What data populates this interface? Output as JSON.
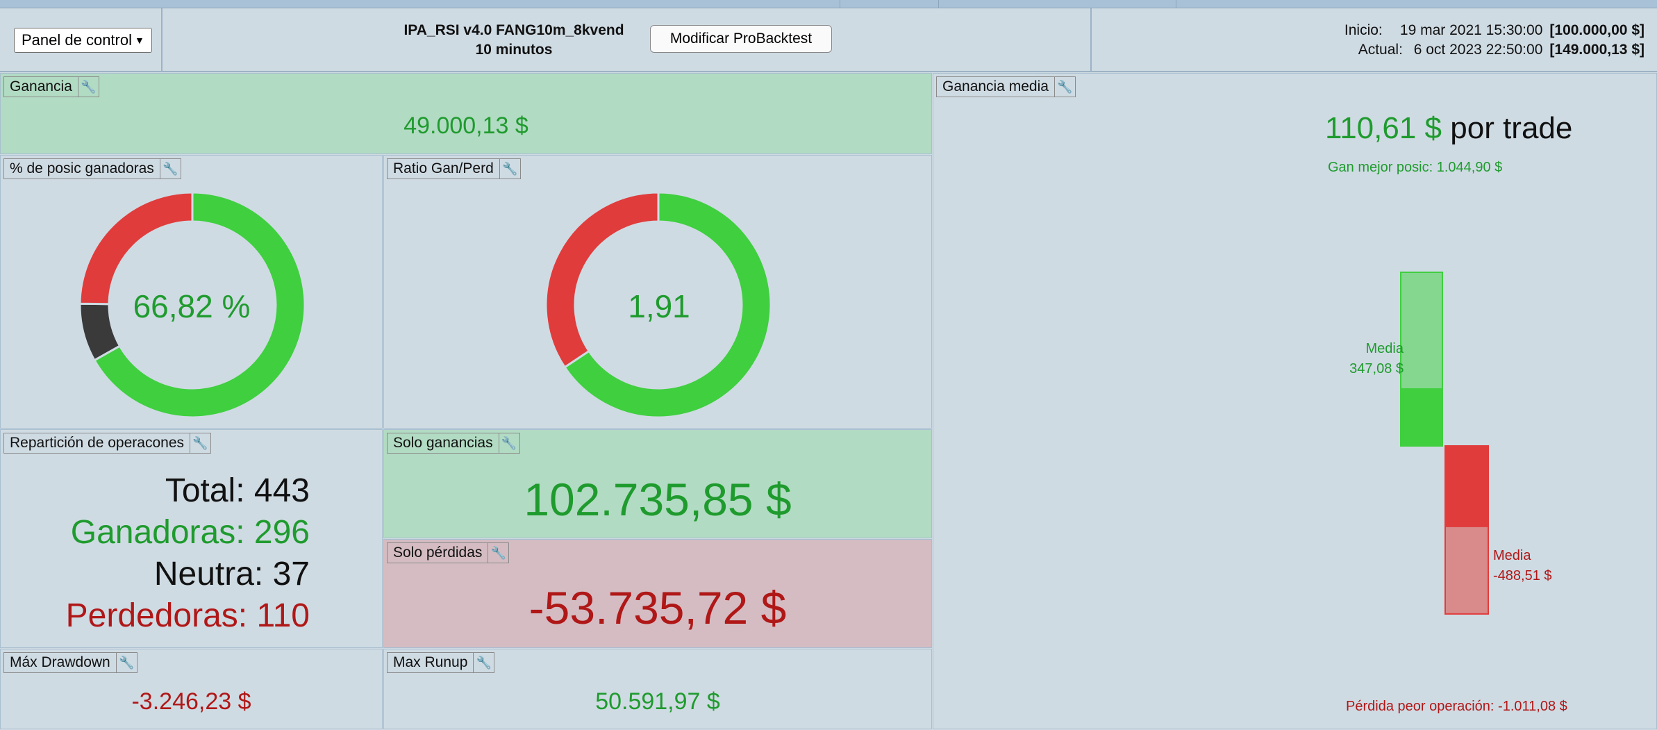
{
  "header": {
    "dashboard_label": "Panel de control",
    "strategy_name": "IPA_RSI v4.0 FANG10m_8kvend",
    "timeframe": "10 minutos",
    "modify_button": "Modificar ProBacktest",
    "start_label": "Inicio:",
    "start_date": "19 mar 2021 15:30:00",
    "start_value": "[100.000,00 $]",
    "current_label": "Actual:",
    "current_date": "6 oct 2023 22:50:00",
    "current_value": "[149.000,13 $]"
  },
  "panels": {
    "gain": {
      "title": "Ganancia",
      "value": "49.000,13 $"
    },
    "winning_pct": {
      "title": "% de posic ganadoras",
      "value": "66,82 %"
    },
    "ratio": {
      "title": "Ratio Gan/Perd",
      "value": "1,91"
    },
    "breakdown": {
      "title": "Repartición de operacones",
      "total_label": "Total:",
      "total": "443",
      "winners_label": "Ganadoras:",
      "winners": "296",
      "neutral_label": "Neutra:",
      "neutral": "37",
      "losers_label": "Perdedoras:",
      "losers": "110"
    },
    "only_gains": {
      "title": "Solo ganancias",
      "value": "102.735,85 $"
    },
    "only_losses": {
      "title": "Solo pérdidas",
      "value": "-53.735,72 $"
    },
    "max_drawdown": {
      "title": "Máx Drawdown",
      "value": "-3.246,23 $"
    },
    "max_runup": {
      "title": "Max Runup",
      "value": "50.591,97 $"
    },
    "avg_gain": {
      "title": "Ganancia media",
      "per_trade_value": "110,61 $",
      "per_trade_label": "por trade",
      "best_label": "Gan mejor posic: 1.044,90 $",
      "avg_win_label": "Media",
      "avg_win_value": "347,08 $",
      "avg_loss_label": "Media",
      "avg_loss_value": "-488,51 $",
      "worst_label": "Pérdida peor operación: -1.011,08 $"
    }
  },
  "chart_data": [
    {
      "type": "pie",
      "name": "winning_pct",
      "segments": [
        {
          "label": "Ganadoras",
          "value": 296,
          "color": "#3fcf3f"
        },
        {
          "label": "Neutra",
          "value": 37,
          "color": "#3a3a3a"
        },
        {
          "label": "Perdedoras",
          "value": 110,
          "color": "#e03c3c"
        }
      ]
    },
    {
      "type": "pie",
      "name": "ratio",
      "segments": [
        {
          "label": "Ganancias",
          "value": 102735.85,
          "color": "#3fcf3f"
        },
        {
          "label": "Pérdidas",
          "value": 53735.72,
          "color": "#e03c3c"
        }
      ]
    },
    {
      "type": "bar",
      "name": "avg_gain",
      "categories": [
        "best_win",
        "avg_win",
        "avg_loss",
        "worst_loss"
      ],
      "values": [
        1044.9,
        347.08,
        -488.51,
        -1011.08
      ]
    }
  ],
  "colors": {
    "green_text": "#1f9b2e",
    "red_text": "#b01717",
    "green_panel": "#b2dbc3",
    "red_panel": "#d4bcc2",
    "wrench_icon": "wrench-icon"
  }
}
